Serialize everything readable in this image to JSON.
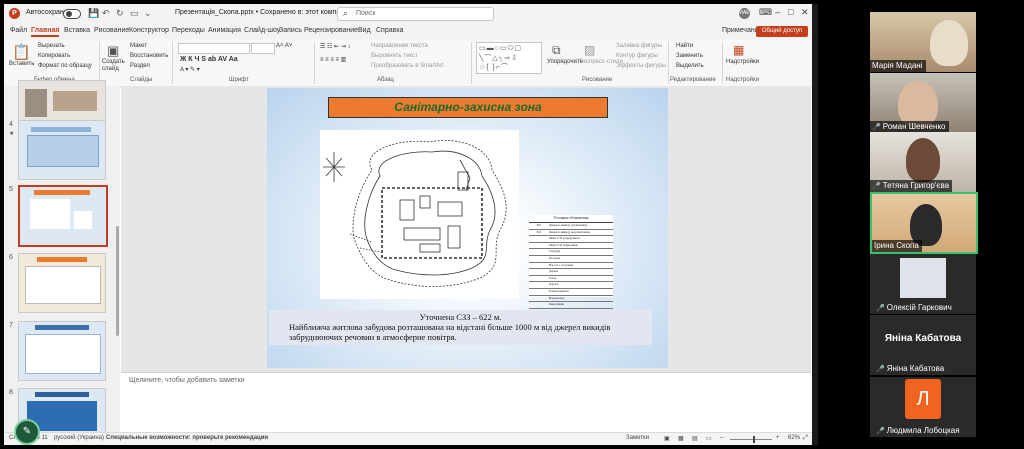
{
  "titlebar": {
    "autosave_label": "Автосохранение",
    "doc_title": "Презентація_Скопа.pptx • Сохранено в: этот компьютер",
    "search_placeholder": "Поиск",
    "user_initials": "ИАЕ",
    "comments_label": "Примечания",
    "share_label": "Общий доступ"
  },
  "menu": {
    "tabs": [
      "Файл",
      "Главная",
      "Вставка",
      "Рисование",
      "Конструктор",
      "Переходы",
      "Анимация",
      "Слайд-шоу",
      "Запись",
      "Рецензирование",
      "Вид",
      "Справка"
    ],
    "active_tab": "Главная"
  },
  "ribbon": {
    "clipboard": {
      "paste": "Вставить",
      "cut": "Вырезать",
      "copy": "Копировать",
      "format": "Формат по образцу",
      "group": "Буфер обмена"
    },
    "slides": {
      "new": "Создать слайд",
      "layout": "Макет",
      "reset": "Восстановить",
      "section": "Раздел",
      "group": "Слайды"
    },
    "font": {
      "group": "Шрифт"
    },
    "paragraph": {
      "text_direction": "Направление текста",
      "align_text": "Выровнять текст",
      "smartart": "Преобразовать в SmartArt",
      "group": "Абзац"
    },
    "drawing": {
      "arrange": "Упорядочить",
      "quick_styles": "Экспресс-стили",
      "fill": "Заливка фигуры",
      "outline": "Контур фигуры",
      "effects": "Эффекты фигуры",
      "group": "Рисование"
    },
    "editing": {
      "find": "Найти",
      "replace": "Заменить",
      "select": "Выделить",
      "group": "Редактирование"
    },
    "addins": {
      "label": "Надстройки",
      "group": "Надстройки"
    }
  },
  "slide_panel": {
    "numbers": [
      "4",
      "5",
      "6",
      "7",
      "8"
    ],
    "selected": "5"
  },
  "slide": {
    "title": "Санітарно-захисна зона",
    "legend_title": "Условные обозначения",
    "legend_rows": [
      [
        "001",
        "Джерело викиду організоване"
      ],
      [
        "001",
        "Джерело викиду неорганізоване"
      ],
      [
        "",
        "Межа СЗЗ розрахункова"
      ],
      [
        "",
        "Межа СЗЗ нормативна"
      ],
      [
        "",
        "Споруди"
      ],
      [
        "",
        "Огорожа"
      ],
      [
        "",
        "Ворота з огорожею"
      ],
      [
        "",
        "Дерева"
      ],
      [
        "",
        "Газон"
      ],
      [
        "",
        "Дороги"
      ],
      [
        "",
        "Електромережа"
      ],
      [
        "",
        "Водопровод"
      ],
      [
        "",
        "Каналізація"
      ]
    ],
    "text_line1": "Уточнена СЗЗ – 622 м.",
    "text_line2": "Найближча житлова забудова розташована на відстані більше 1000 м від джерел викидів забруднюючих речовин в атмосферне повітря."
  },
  "notes_placeholder": "Щелкните, чтобы добавить заметки",
  "status": {
    "slide_label": "Слайд 5 из 11",
    "language": "русский (Украина)",
    "accessibility": "Специальные возможности: проверьте рекомендации",
    "notes_btn": "Заметки",
    "zoom": "62%"
  },
  "participants": [
    {
      "name": "Марія Мадані",
      "muted": false
    },
    {
      "name": "Роман Шевченко",
      "muted": true
    },
    {
      "name": "Тетяна Григор'єва",
      "muted": true
    },
    {
      "name": "Ірина Скопа",
      "muted": false,
      "speaking": true
    },
    {
      "name": "Олексій Гаркович",
      "muted": true
    },
    {
      "name": "Яніна Кабатова",
      "muted": true,
      "name_only": true
    },
    {
      "name": "Людмила Лобоцкая",
      "muted": true,
      "initial": "Л"
    }
  ],
  "colors": {
    "accent": "#c43e1c",
    "title_fill": "#ed7b2f",
    "title_text": "#1a6a2f",
    "speaker_border": "#35c46b"
  }
}
